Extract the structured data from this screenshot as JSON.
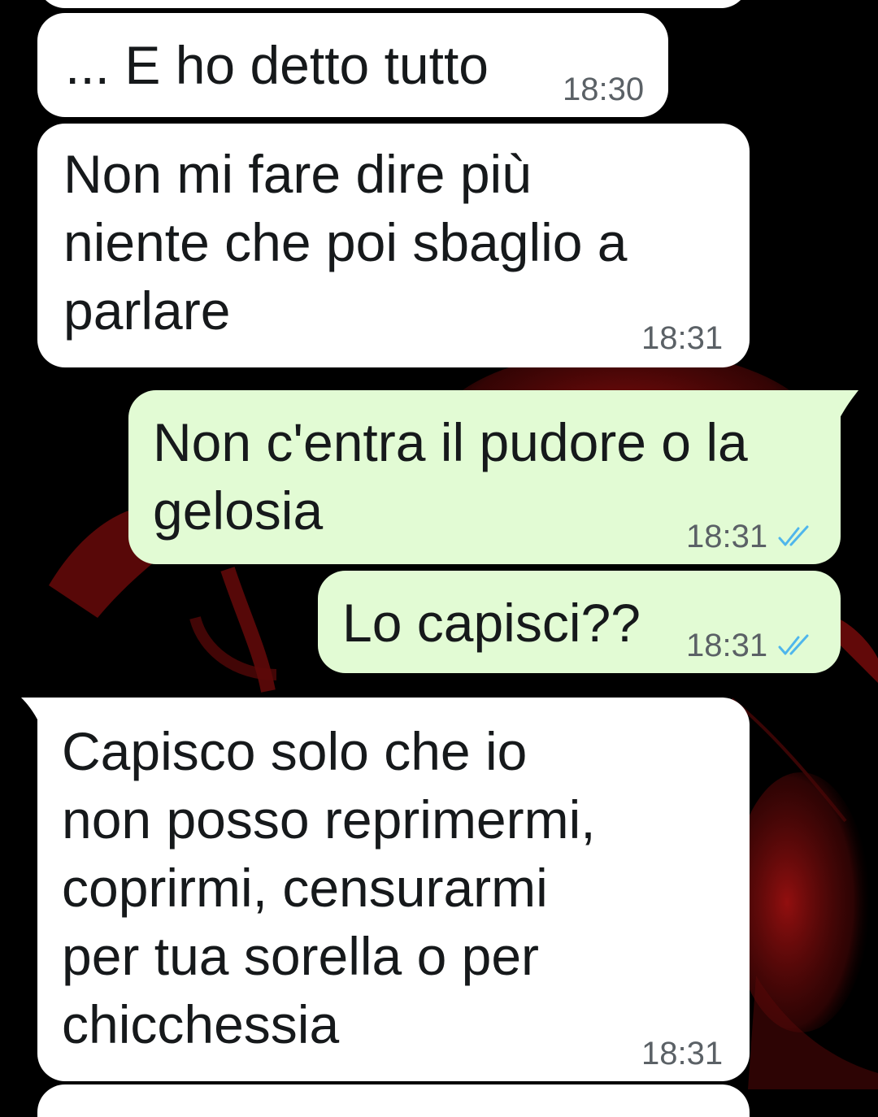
{
  "chat": {
    "messages": [
      {
        "direction": "incoming",
        "text": "... E ho detto tutto",
        "time": "18:30"
      },
      {
        "direction": "incoming",
        "text": "Non mi fare dire più\nniente che poi sbaglio a\nparlare",
        "time": "18:31"
      },
      {
        "direction": "outgoing",
        "text": "Non c'entra il pudore o la\ngelosia",
        "time": "18:31",
        "status_icon": "double-check-read-icon"
      },
      {
        "direction": "outgoing",
        "text": "Lo capisci??",
        "time": "18:31",
        "status_icon": "double-check-read-icon"
      },
      {
        "direction": "incoming",
        "text": "Capisco solo che io\nnon posso reprimermi,\ncoprirmi, censurarmi\nper tua sorella o per\nchicchessia",
        "time": "18:31"
      }
    ]
  },
  "colors": {
    "background": "#000000",
    "incoming_bubble": "#ffffff",
    "outgoing_bubble": "#e2fbd4",
    "message_text": "#16191b",
    "timestamp": "#5b6166",
    "read_ticks": "#4fb6ec",
    "wallpaper_accent": "#8a0d0d"
  }
}
